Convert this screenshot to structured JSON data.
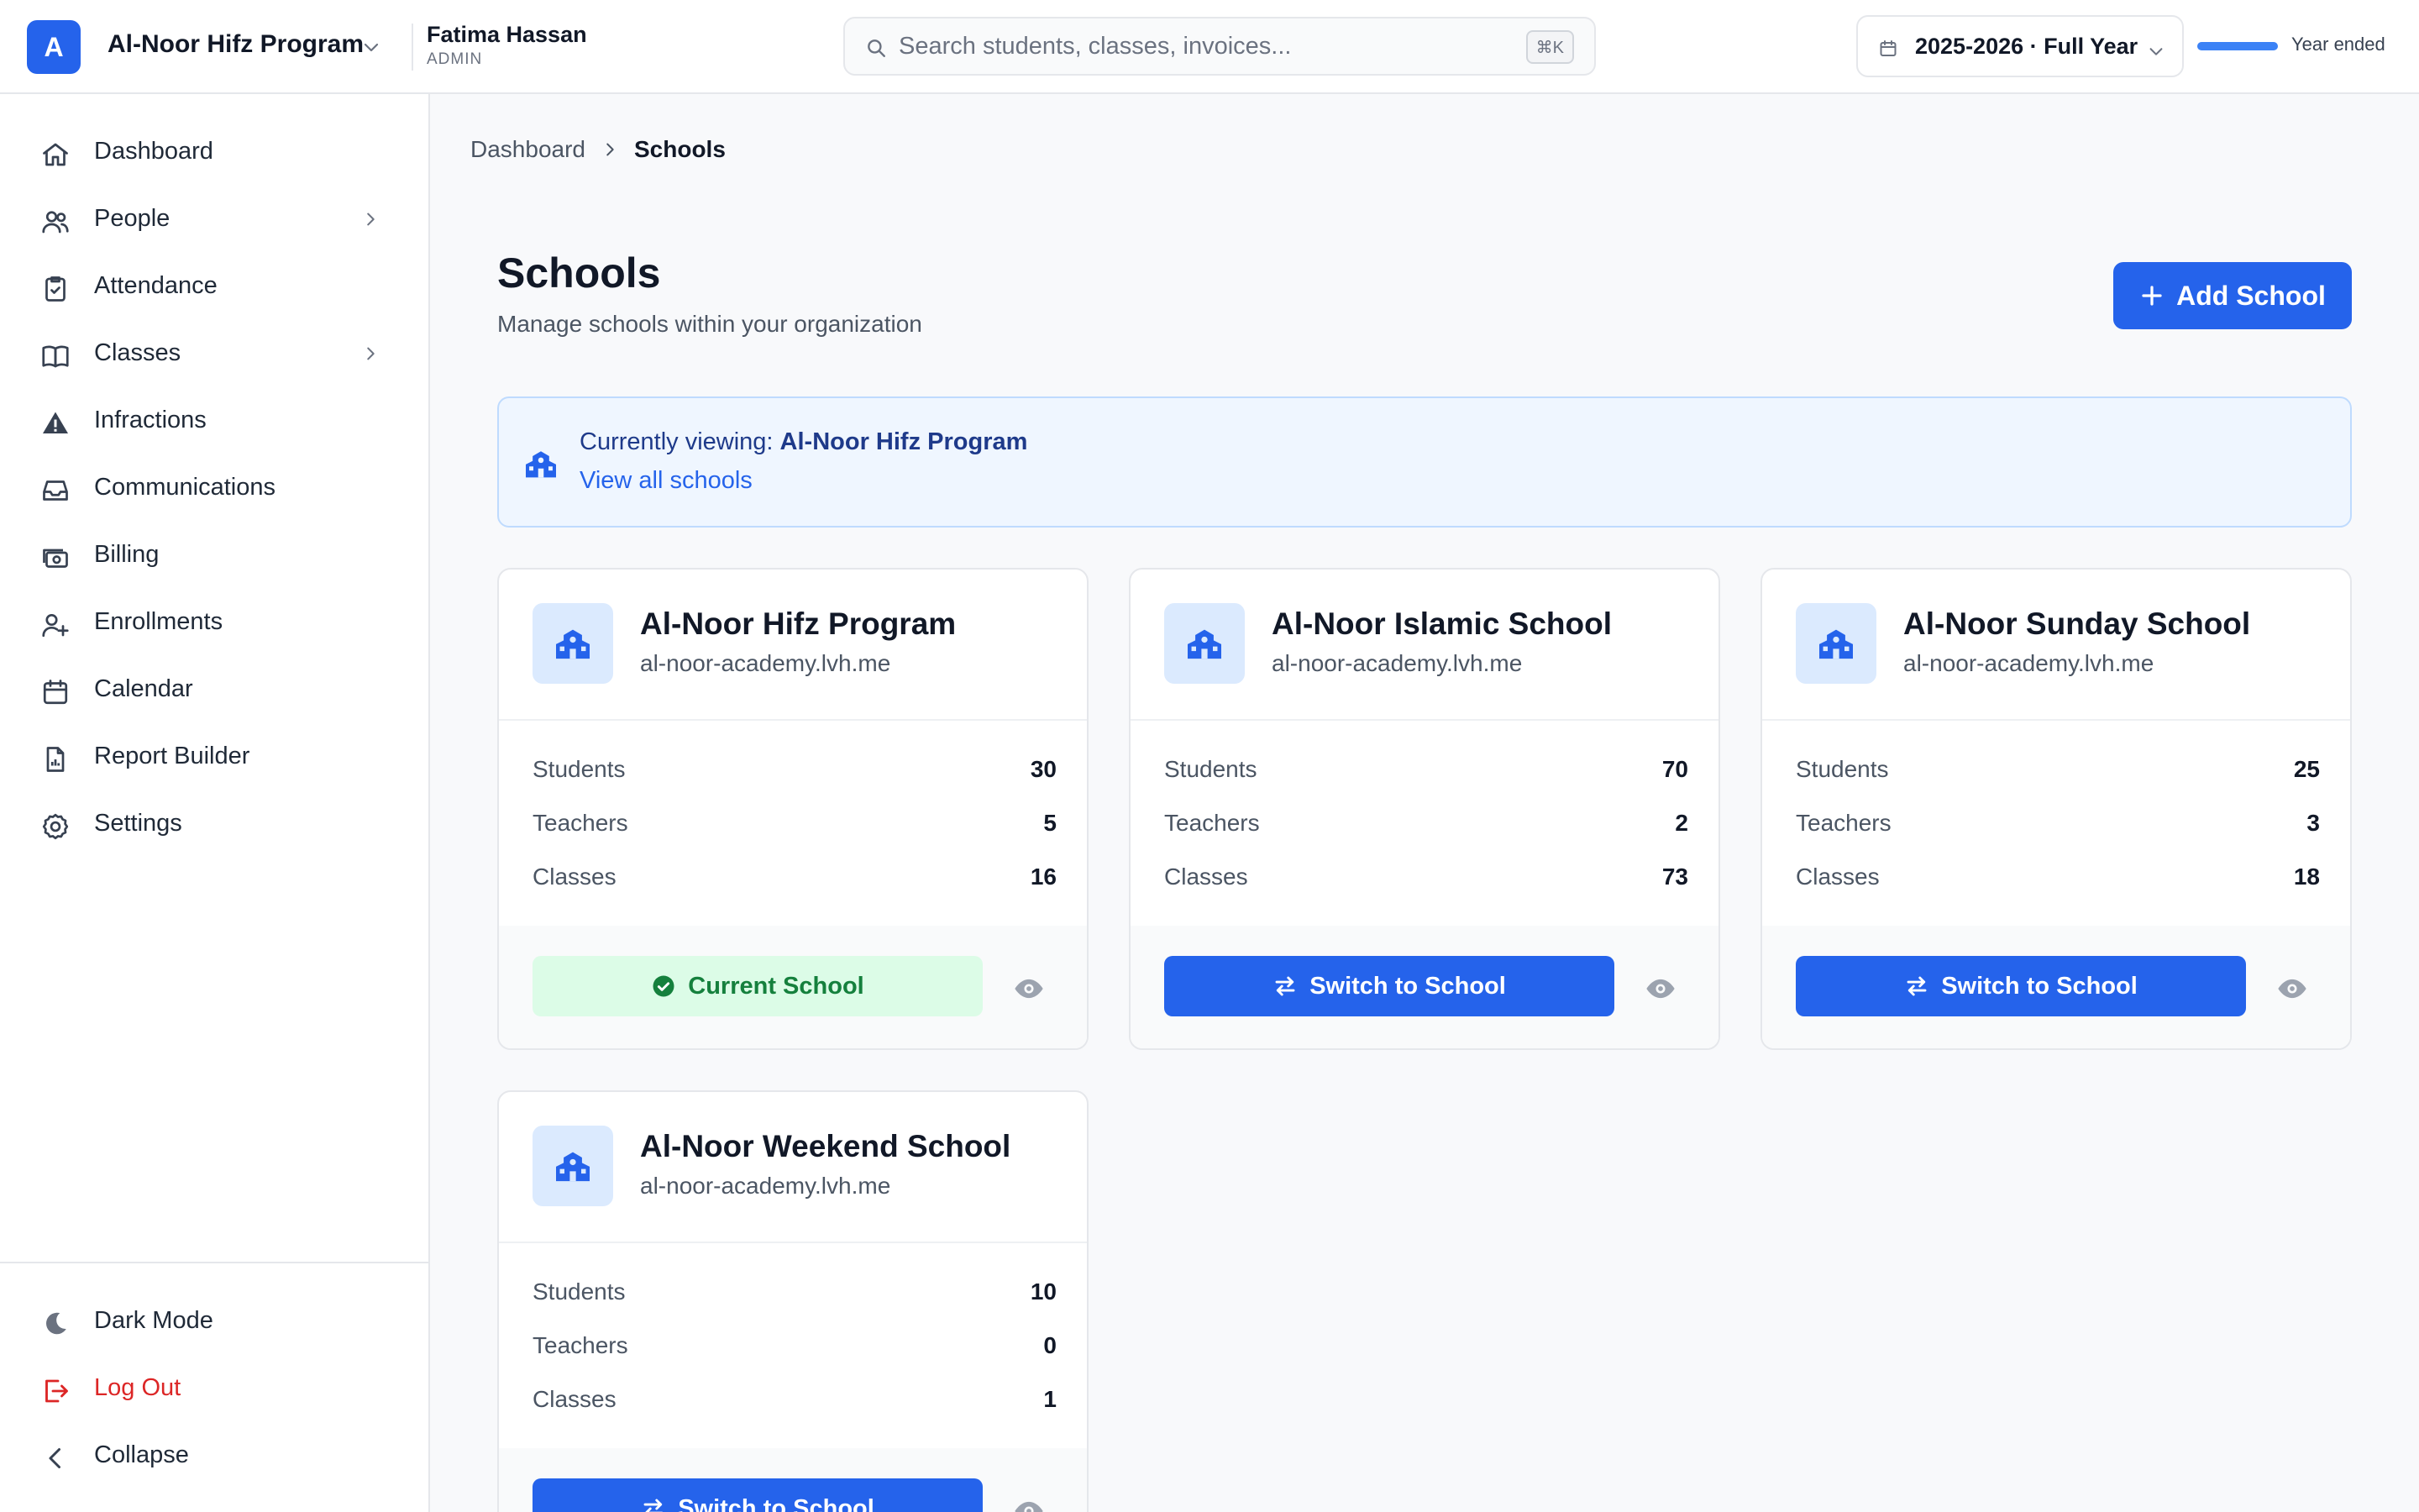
{
  "header": {
    "org_initial": "A",
    "org_name": "Al-Noor Hifz Program",
    "user_name": "Fatima Hassan",
    "user_role": "ADMIN",
    "search_placeholder": "Search students, classes, invoices...",
    "search_shortcut": "⌘K",
    "year_label": "2025-2026 · Full Year",
    "year_progress_percent": 100,
    "year_status": "Year ended"
  },
  "sidebar": {
    "items": [
      {
        "label": "Dashboard",
        "icon": "home-icon"
      },
      {
        "label": "People",
        "icon": "users-icon",
        "expandable": true
      },
      {
        "label": "Attendance",
        "icon": "clipboard-check-icon"
      },
      {
        "label": "Classes",
        "icon": "book-icon",
        "expandable": true
      },
      {
        "label": "Infractions",
        "icon": "warning-icon"
      },
      {
        "label": "Communications",
        "icon": "inbox-icon"
      },
      {
        "label": "Billing",
        "icon": "money-icon"
      },
      {
        "label": "Enrollments",
        "icon": "user-plus-icon"
      },
      {
        "label": "Calendar",
        "icon": "calendar-icon"
      },
      {
        "label": "Report Builder",
        "icon": "report-icon"
      },
      {
        "label": "Settings",
        "icon": "gear-icon"
      }
    ],
    "bottom": {
      "dark_mode": "Dark Mode",
      "logout": "Log Out",
      "collapse": "Collapse"
    }
  },
  "breadcrumb": {
    "parent": "Dashboard",
    "current": "Schools"
  },
  "page": {
    "title": "Schools",
    "subtitle": "Manage schools within your organization",
    "add_button": "Add School"
  },
  "banner": {
    "prefix": "Currently viewing:",
    "school": "Al-Noor Hifz Program",
    "link": "View all schools"
  },
  "labels": {
    "students": "Students",
    "teachers": "Teachers",
    "classes": "Classes",
    "current_school": "Current School",
    "switch_to_school": "Switch to School"
  },
  "schools": [
    {
      "name": "Al-Noor Hifz Program",
      "domain": "al-noor-academy.lvh.me",
      "students": "30",
      "teachers": "5",
      "classes": "16",
      "current": true
    },
    {
      "name": "Al-Noor Islamic School",
      "domain": "al-noor-academy.lvh.me",
      "students": "70",
      "teachers": "2",
      "classes": "73",
      "current": false
    },
    {
      "name": "Al-Noor Sunday School",
      "domain": "al-noor-academy.lvh.me",
      "students": "25",
      "teachers": "3",
      "classes": "18",
      "current": false
    },
    {
      "name": "Al-Noor Weekend School",
      "domain": "al-noor-academy.lvh.me",
      "students": "10",
      "teachers": "0",
      "classes": "1",
      "current": false
    }
  ],
  "colors": {
    "accent": "#2563eb",
    "success_bg": "#dcfce7",
    "success_text": "#15803d",
    "danger": "#dc2626",
    "banner_bg": "#eff6ff"
  }
}
